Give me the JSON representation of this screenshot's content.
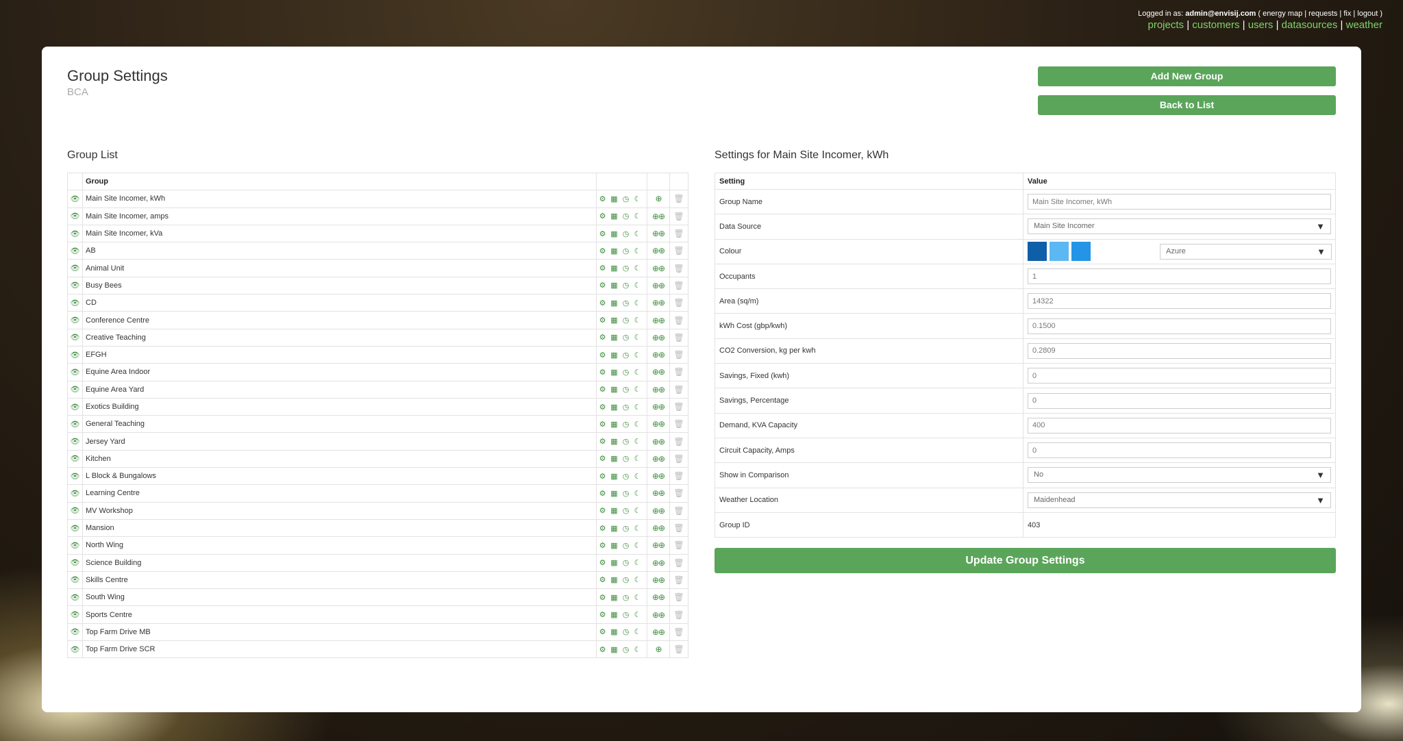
{
  "header": {
    "logged_in_label": "Logged in as:",
    "user": "admin@envisij.com",
    "links_small": "( energy map | requests | fix | logout )",
    "nav": [
      "projects",
      "customers",
      "users",
      "datasources",
      "weather"
    ],
    "sep": "|"
  },
  "page": {
    "title": "Group Settings",
    "subtitle": "BCA",
    "add_button": "Add New Group",
    "back_button": "Back to List"
  },
  "group_list": {
    "title": "Group List",
    "column_group": "Group",
    "rows": [
      "Main Site Incomer, kWh",
      "Main Site Incomer, amps",
      "Main Site Incomer, kVa",
      "AB",
      "Animal Unit",
      "Busy Bees",
      "CD",
      "Conference Centre",
      "Creative Teaching",
      "EFGH",
      "Equine Area Indoor",
      "Equine Area Yard",
      "Exotics Building",
      "General Teaching",
      "Jersey Yard",
      "Kitchen",
      "L Block & Bungalows",
      "Learning Centre",
      "MV Workshop",
      "Mansion",
      "North Wing",
      "Science Building",
      "Skills Centre",
      "South Wing",
      "Sports Centre",
      "Top Farm Drive MB",
      "Top Farm Drive SCR"
    ]
  },
  "settings": {
    "title": "Settings for Main Site Incomer, kWh",
    "col_setting": "Setting",
    "col_value": "Value",
    "group_name_label": "Group Name",
    "group_name_value": "Main Site Incomer, kWh",
    "data_source_label": "Data Source",
    "data_source_value": "Main Site Incomer",
    "colour_label": "Colour",
    "colour_value": "Azure",
    "colour_swatches": [
      "#0f5ea8",
      "#5bb8f2",
      "#2494e6"
    ],
    "occupants_label": "Occupants",
    "occupants_value": "1",
    "area_label": "Area (sq/m)",
    "area_value": "14322",
    "kwh_cost_label": "kWh Cost (gbp/kwh)",
    "kwh_cost_value": "0.1500",
    "co2_label": "CO2 Conversion, kg per kwh",
    "co2_value": "0.2809",
    "savings_fixed_label": "Savings, Fixed (kwh)",
    "savings_fixed_value": "0",
    "savings_pct_label": "Savings, Percentage",
    "savings_pct_value": "0",
    "demand_label": "Demand, KVA Capacity",
    "demand_value": "400",
    "circuit_label": "Circuit Capacity, Amps",
    "circuit_value": "0",
    "show_comp_label": "Show in Comparison",
    "show_comp_value": "No",
    "weather_label": "Weather Location",
    "weather_value": "Maidenhead",
    "group_id_label": "Group ID",
    "group_id_value": "403",
    "update_button": "Update Group Settings"
  },
  "icons": {
    "eye": "eye-icon",
    "gear": "gear-icon",
    "calendar": "calendar-icon",
    "clock": "clock-icon",
    "moon": "moon-icon",
    "go": "go-icon",
    "delete": "trash-icon"
  }
}
